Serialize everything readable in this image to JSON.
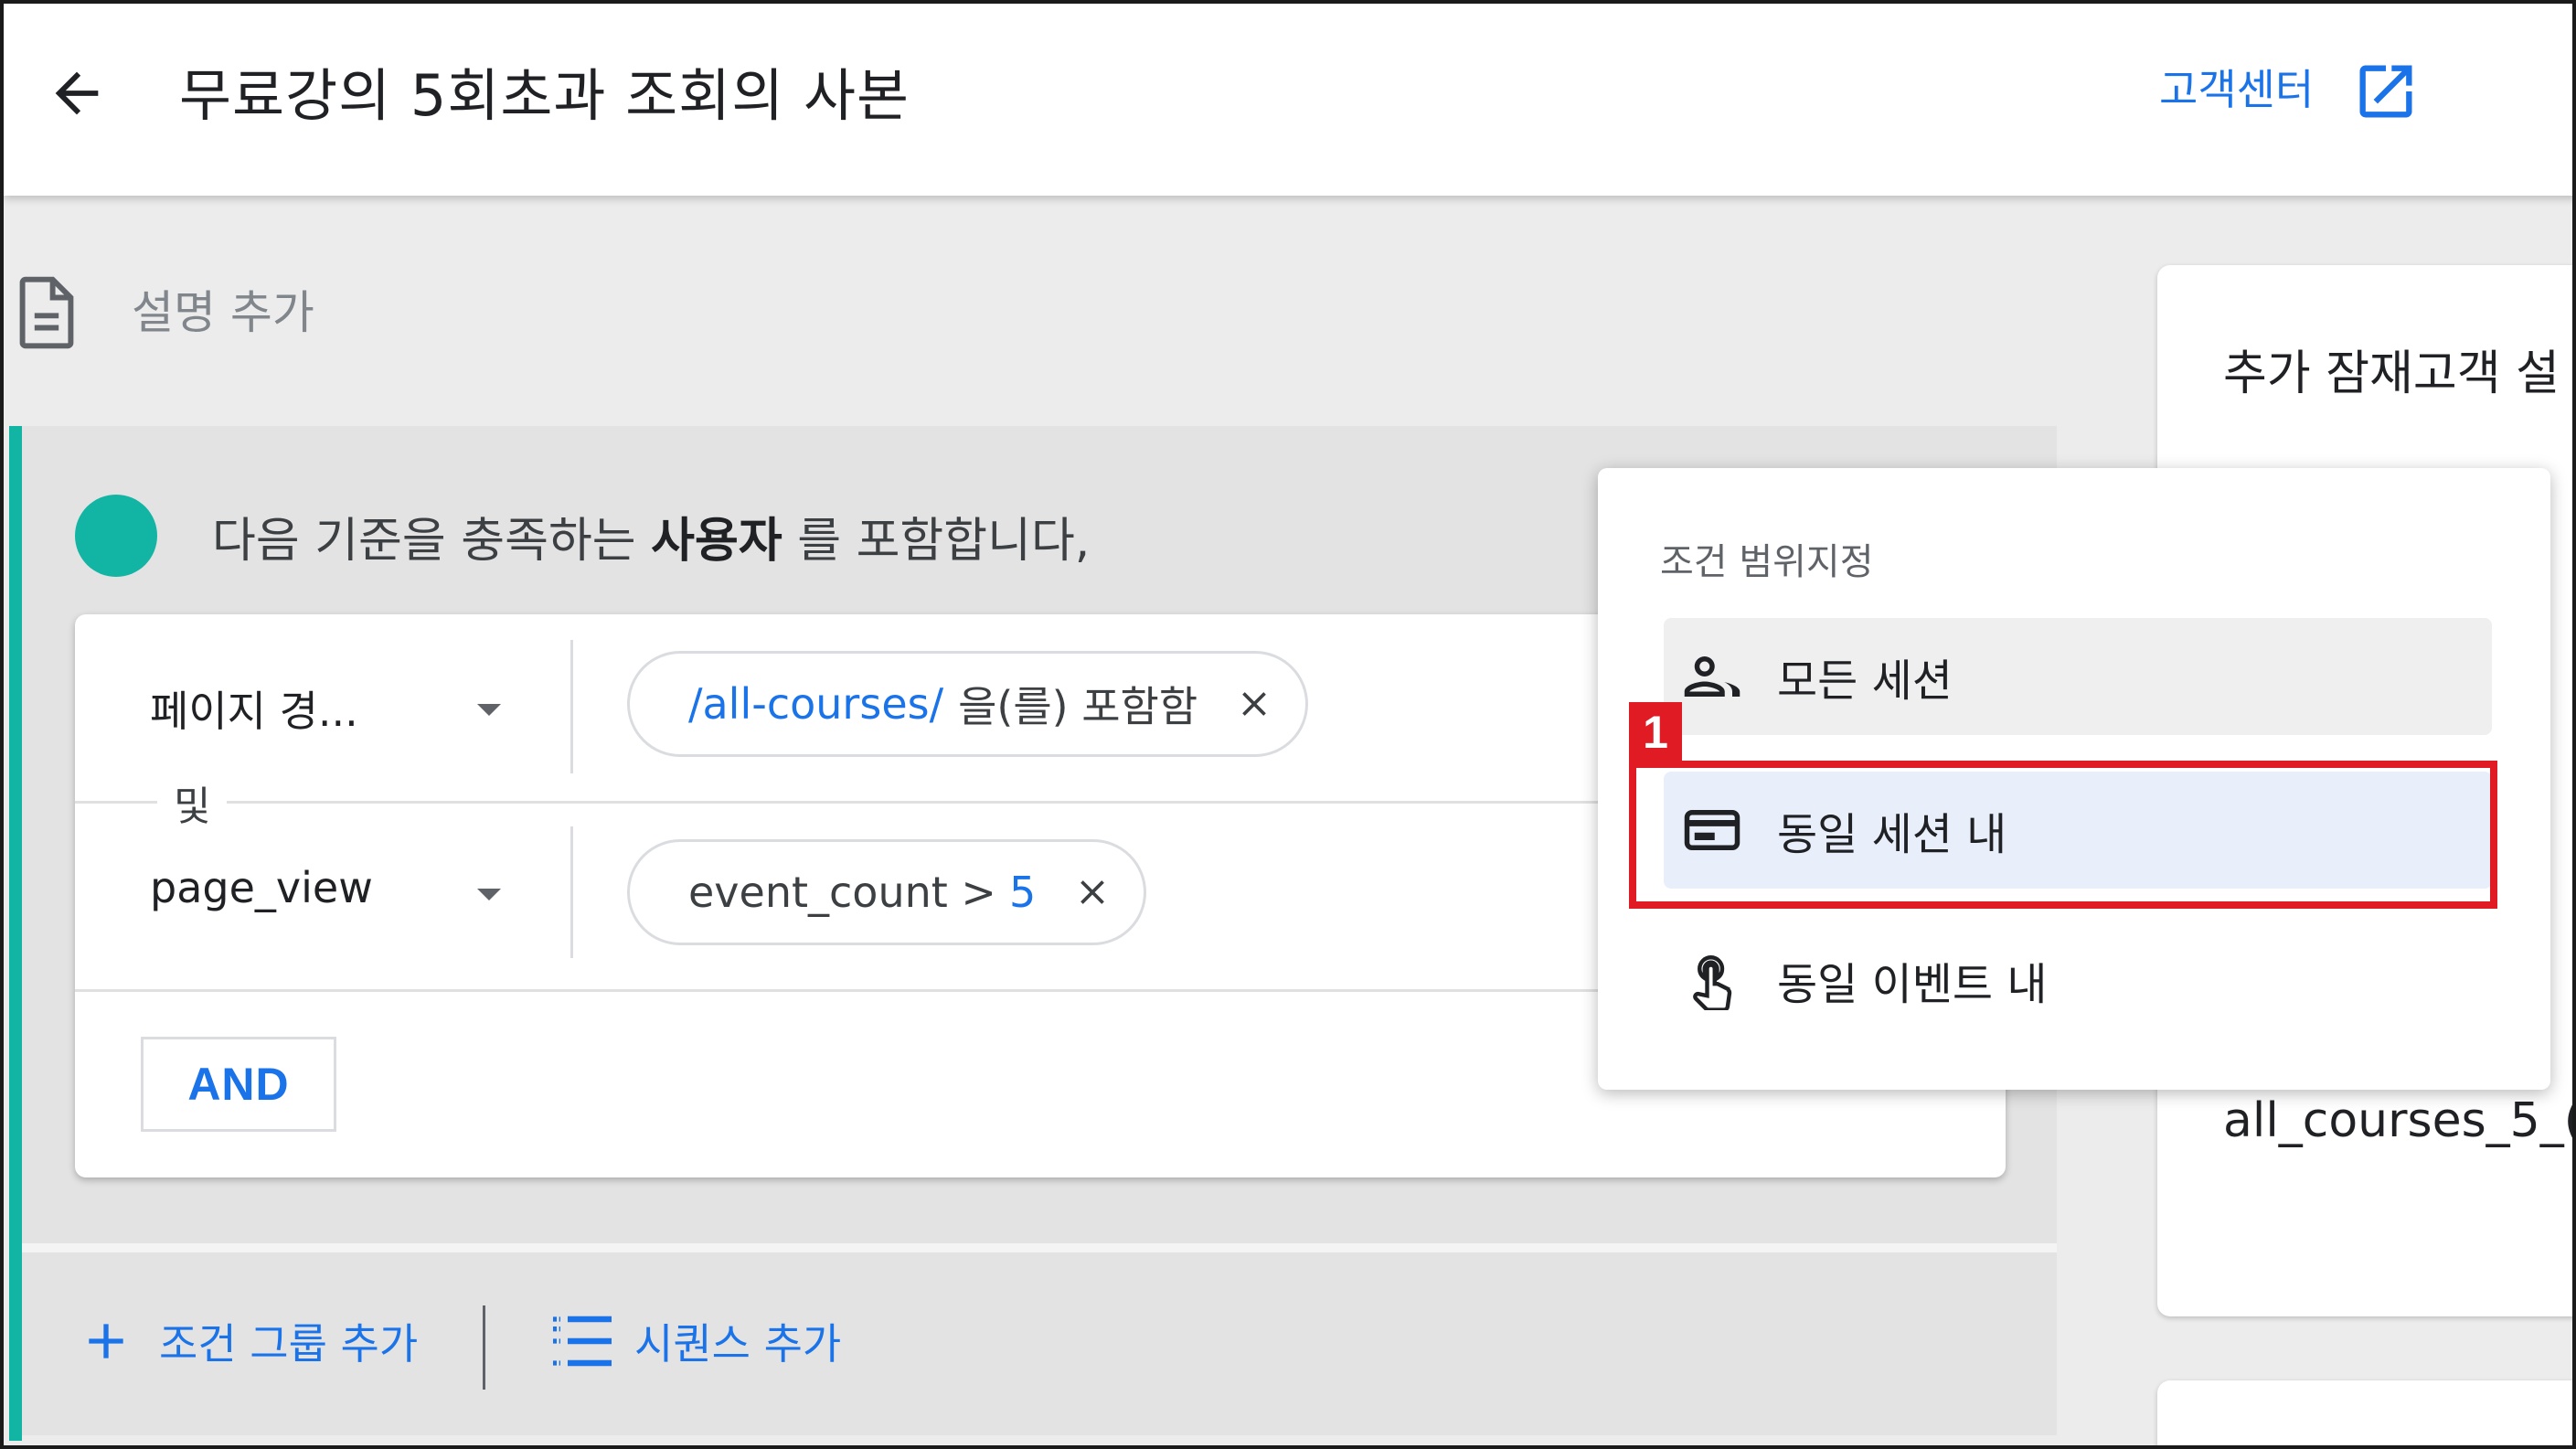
{
  "header": {
    "title": "무료강의 5회초과 조회의 사본",
    "help_label": "고객센터"
  },
  "description": {
    "placeholder": "설명 추가"
  },
  "condition_group": {
    "include_prefix": "다음 기준을 충족하는",
    "include_subject": "사용자",
    "include_suffix": "를 포함합니다,",
    "conditions": [
      {
        "dimension": "페이지 경...",
        "chip_value": "/all-courses/",
        "chip_operator": "을(를) 포함함"
      },
      {
        "dimension": "page_view",
        "chip_param": "event_count >",
        "chip_value": "5"
      }
    ],
    "and_connector": "및",
    "and_button": "AND"
  },
  "footer": {
    "add_group": "조건 그룹 추가",
    "add_sequence": "시퀀스 추가"
  },
  "right_panel": {
    "title": "추가 잠재고객 설",
    "value": "all_courses_5_("
  },
  "menu": {
    "title": "조건 범위지정",
    "items": [
      {
        "label": "모든 세션",
        "icon": "people-icon"
      },
      {
        "label": "동일 세션 내",
        "icon": "session-card-icon"
      },
      {
        "label": "동일 이벤트 내",
        "icon": "touch-icon"
      }
    ]
  },
  "annotation": {
    "badge": "1",
    "color": "#e01b24"
  },
  "colors": {
    "accent": "#1a73e8",
    "teal": "#12b5a4"
  }
}
